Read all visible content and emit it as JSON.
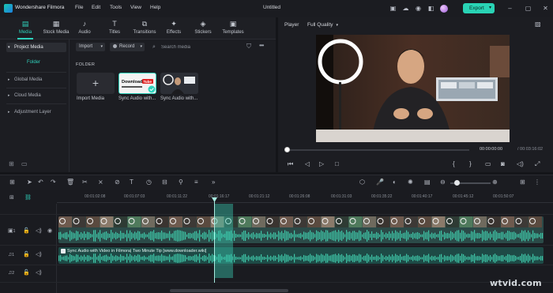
{
  "titlebar": {
    "app_name": "Wondershare Filmora",
    "menu": [
      "File",
      "Edit",
      "Tools",
      "View",
      "Help"
    ],
    "project_title": "Untitled",
    "export_label": "Export"
  },
  "media_tabs": [
    {
      "label": "Media",
      "icon": "media-icon",
      "active": true
    },
    {
      "label": "Stock Media",
      "icon": "stock-media-icon"
    },
    {
      "label": "Audio",
      "icon": "music-note-icon"
    },
    {
      "label": "Titles",
      "icon": "titles-icon"
    },
    {
      "label": "Transitions",
      "icon": "transitions-icon"
    },
    {
      "label": "Effects",
      "icon": "effects-icon"
    },
    {
      "label": "Stickers",
      "icon": "stickers-icon"
    },
    {
      "label": "Templates",
      "icon": "templates-icon"
    }
  ],
  "sidebar": {
    "project_media": "Project Media",
    "folder": "Folder",
    "items": [
      "Global Media",
      "Cloud Media",
      "Adjustment Layer"
    ]
  },
  "toolbar": {
    "import_label": "Import",
    "record_label": "Record",
    "search_placeholder": "Search media"
  },
  "media": {
    "folder_label": "FOLDER",
    "cards": [
      {
        "label": "Import Media"
      },
      {
        "label": "Sync Audio with...",
        "thumb_text": "Download",
        "thumb_badge": "Tube"
      },
      {
        "label": "Sync Audio with..."
      }
    ]
  },
  "player": {
    "label": "Player",
    "quality": "Full Quality",
    "time_current": "00:00:00:00",
    "time_total": "/ 00:03:16:02",
    "progress": 0
  },
  "timeline": {
    "ticks": [
      "00:01:02:08",
      "00:01:07:03",
      "00:01:11:22",
      "00:01:16:17",
      "00:01:21:12",
      "00:01:26:08",
      "00:01:31:03",
      "00:01:35:22",
      "00:01:40:17",
      "00:01:45:12",
      "00:01:50:07"
    ],
    "tracks": [
      {
        "index": "1",
        "type": "video"
      },
      {
        "index": "1",
        "type": "audio"
      },
      {
        "index": "2",
        "type": "audio"
      }
    ],
    "audio_clip_title": "Sync Audio with Video in Filmora| Two Minute Tip [www.downloader.wiki]"
  },
  "watermark": "wtvid.com",
  "colors": {
    "accent": "#2fd2bc",
    "export": "#29d3b5",
    "background": "#141519"
  }
}
